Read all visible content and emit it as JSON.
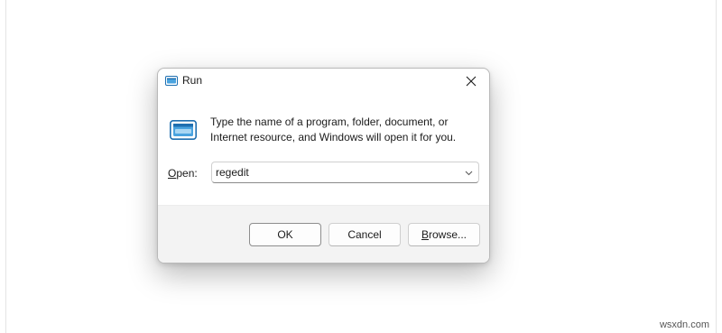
{
  "dialog": {
    "title": "Run",
    "description": "Type the name of a program, folder, document, or Internet resource, and Windows will open it for you.",
    "open_label_accel": "O",
    "open_label_rest": "pen:",
    "input_value": "regedit",
    "buttons": {
      "ok": "OK",
      "cancel": "Cancel",
      "browse_accel": "B",
      "browse_rest": "rowse..."
    },
    "icons": {
      "title": "run-icon",
      "content": "run-icon",
      "close": "close-icon",
      "dropdown": "chevron-down-icon"
    }
  },
  "watermark": "wsxdn.com",
  "colors": {
    "icon_blue": "#4aa3df",
    "icon_dark": "#1f6fb0",
    "footer_bg": "#f3f3f3"
  }
}
